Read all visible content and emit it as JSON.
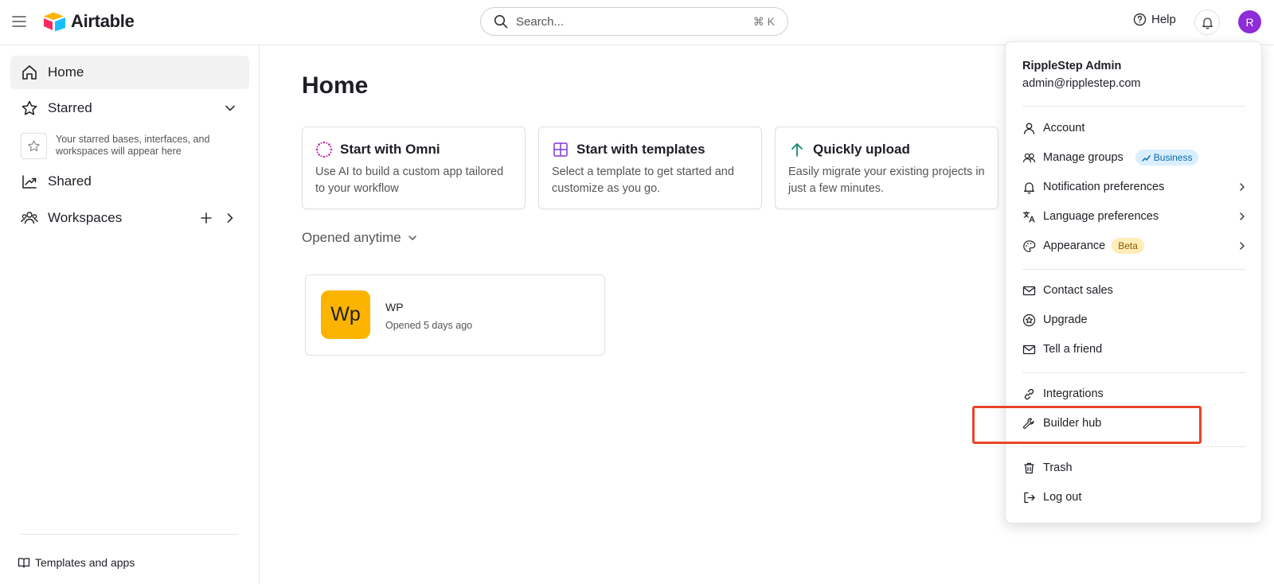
{
  "app": {
    "name": "Airtable"
  },
  "header": {
    "search_placeholder": "Search...",
    "search_shortcut": "⌘ K",
    "help_label": "Help",
    "avatar_initial": "R"
  },
  "sidebar": {
    "home": "Home",
    "starred": "Starred",
    "starred_empty": "Your starred bases, interfaces, and workspaces will appear here",
    "shared": "Shared",
    "workspaces": "Workspaces",
    "templates": "Templates and apps"
  },
  "main": {
    "title": "Home",
    "cards": [
      {
        "title": "Start with Omni",
        "desc": "Use AI to build a custom app tailored to your workflow",
        "icon": "omni-icon"
      },
      {
        "title": "Start with templates",
        "desc": "Select a template to get started and customize as you go.",
        "icon": "grid-icon"
      },
      {
        "title": "Quickly upload",
        "desc": "Easily migrate your existing projects in just a few minutes.",
        "icon": "arrow-up-icon"
      }
    ],
    "opened_filter": "Opened anytime",
    "bases": [
      {
        "abbr": "Wp",
        "name": "WP",
        "opened": "Opened 5 days ago",
        "color": "#fcb400"
      }
    ]
  },
  "account_menu": {
    "user_name": "RippleStep Admin",
    "user_email": "admin@ripplestep.com",
    "items": [
      {
        "label": "Account",
        "icon": "user-icon"
      },
      {
        "label": "Manage groups",
        "icon": "users-icon",
        "badge": "Business"
      },
      {
        "label": "Notification preferences",
        "icon": "bell-icon"
      },
      {
        "label": "Language preferences",
        "icon": "translate-icon"
      },
      {
        "label": "Appearance",
        "icon": "palette-icon",
        "badge": "Beta"
      },
      {
        "label": "Contact sales",
        "icon": "envelope-icon"
      },
      {
        "label": "Upgrade",
        "icon": "star-badge-icon"
      },
      {
        "label": "Tell a friend",
        "icon": "envelope-icon"
      },
      {
        "label": "Integrations",
        "icon": "link-icon"
      },
      {
        "label": "Builder hub",
        "icon": "wrench-icon"
      },
      {
        "label": "Trash",
        "icon": "trash-icon"
      },
      {
        "label": "Log out",
        "icon": "logout-icon"
      }
    ]
  },
  "colors": {
    "accent": "#8d2cd8",
    "highlight": "#e8452c",
    "base_yellow": "#fcb400"
  }
}
